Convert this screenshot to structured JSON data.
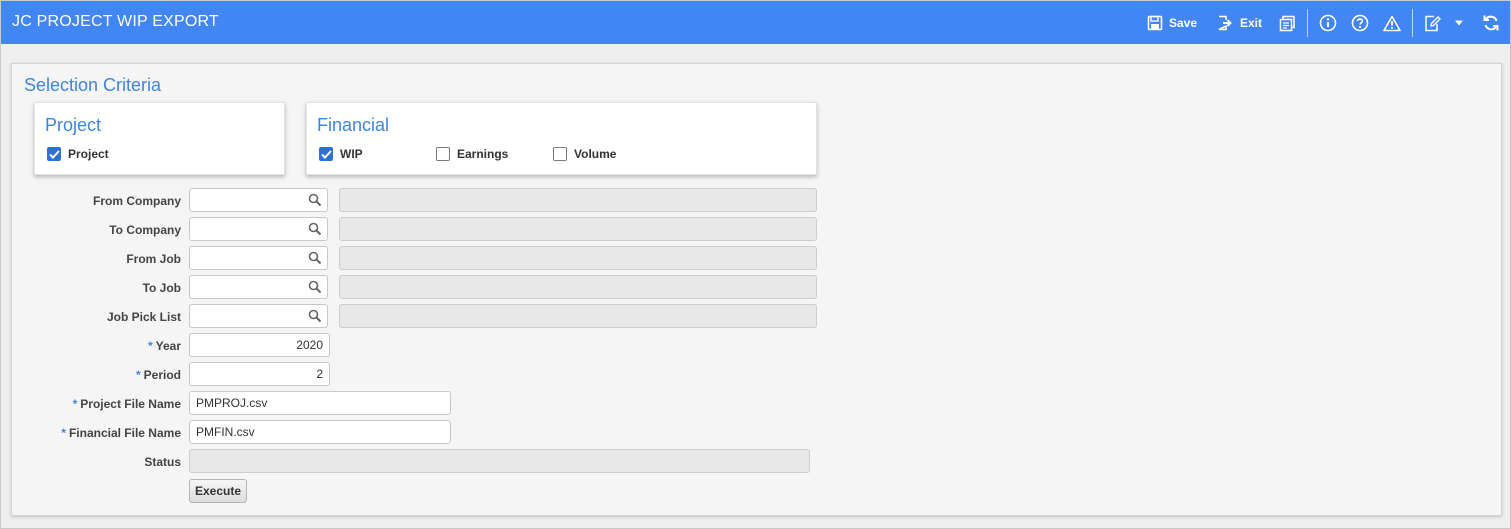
{
  "app": {
    "title": "JC PROJECT WIP EXPORT"
  },
  "toolbar": {
    "save_label": "Save",
    "exit_label": "Exit",
    "icons": [
      "save-icon",
      "exit-icon",
      "print-icon",
      "info-icon",
      "help-icon",
      "warning-icon",
      "notes-icon",
      "chevron-down-icon",
      "refresh-icon"
    ]
  },
  "selection": {
    "title": "Selection Criteria",
    "project_group": {
      "title": "Project",
      "checkbox": {
        "label": "Project",
        "checked": true
      }
    },
    "financial_group": {
      "title": "Financial",
      "checkboxes": [
        {
          "label": "WIP",
          "checked": true
        },
        {
          "label": "Earnings",
          "checked": false
        },
        {
          "label": "Volume",
          "checked": false
        }
      ]
    }
  },
  "form": {
    "from_company": {
      "label": "From Company",
      "value": ""
    },
    "to_company": {
      "label": "To Company",
      "value": ""
    },
    "from_job": {
      "label": "From Job",
      "value": ""
    },
    "to_job": {
      "label": "To Job",
      "value": ""
    },
    "job_pick_list": {
      "label": "Job Pick List",
      "value": ""
    },
    "year": {
      "label": "Year",
      "value": "2020",
      "required_mark": "*"
    },
    "period": {
      "label": "Period",
      "value": "2",
      "required_mark": "*"
    },
    "project_file_name": {
      "label": "Project File Name",
      "value": "PMPROJ.csv",
      "required_mark": "*"
    },
    "financial_file_name": {
      "label": "Financial File Name",
      "value": "PMFIN.csv",
      "required_mark": "*"
    },
    "status": {
      "label": "Status",
      "value": ""
    },
    "execute_label": "Execute"
  },
  "colors": {
    "header_bg": "#4286f4",
    "accent": "#3d85e0",
    "checkbox_checked": "#2f6fd8"
  }
}
